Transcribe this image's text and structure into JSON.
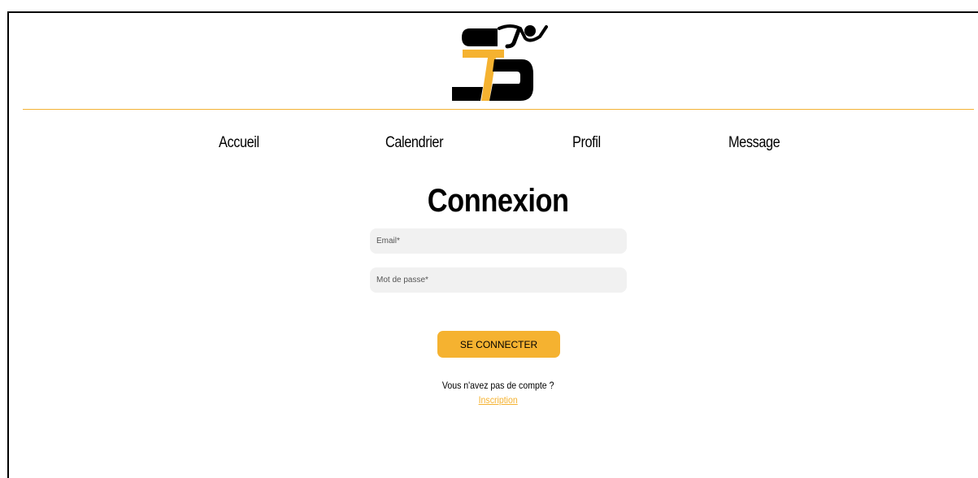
{
  "colors": {
    "accent": "#f5b230",
    "divider": "#f3b233",
    "text": "#000000",
    "input_background": "#f1f1f1"
  },
  "header": {
    "logo_icon": "sts-runner-logo-icon"
  },
  "nav": {
    "items": [
      {
        "label": "Accueil"
      },
      {
        "label": "Calendrier"
      },
      {
        "label": "Profil"
      },
      {
        "label": "Message"
      }
    ]
  },
  "login": {
    "title": "Connexion",
    "email": {
      "placeholder": "Email*",
      "value": ""
    },
    "password": {
      "placeholder": "Mot de passe*",
      "value": ""
    },
    "submit_label": "SE CONNECTER",
    "no_account_text": "Vous n'avez pas de compte ?",
    "signup_link": "Inscription"
  }
}
